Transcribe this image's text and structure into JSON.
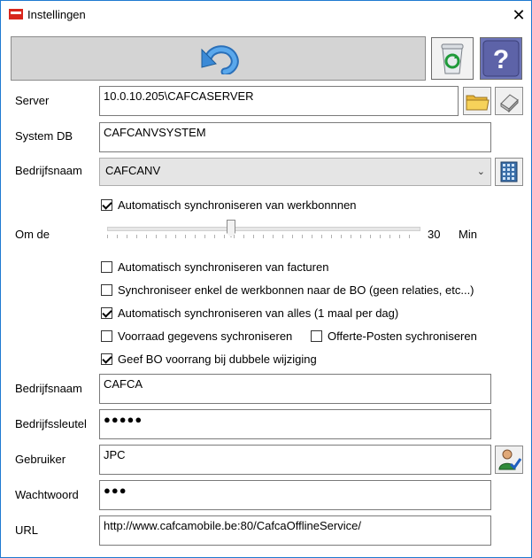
{
  "window": {
    "title": "Instellingen",
    "close_glyph": "✕"
  },
  "toolbar": {
    "undo_icon": "undo-arrow-icon",
    "recycle_icon": "recycle-bin-icon",
    "help_icon": "help-icon"
  },
  "fields": {
    "server_label": "Server",
    "server_value": "10.0.10.205\\CAFCASERVER",
    "systemdb_label": "System DB",
    "systemdb_value": "CAFCANVSYSTEM",
    "bedrijf_label": "Bedrijfsnaam",
    "bedrijf_select_value": "CAFCANV",
    "bedrijf2_label": "Bedrijfsnaam",
    "bedrijf2_value": "CAFCA",
    "sleutel_label": "Bedrijfssleutel",
    "sleutel_value": "●●●●●",
    "gebruiker_label": "Gebruiker",
    "gebruiker_value": "JPC",
    "wachtwoord_label": "Wachtwoord",
    "wachtwoord_value": "●●●",
    "url_label": "URL",
    "url_value": "http://www.cafcamobile.be:80/CafcaOfflineService/"
  },
  "sync": {
    "auto_werkbonnen": {
      "label": "Automatisch synchroniseren van werkbonnnen",
      "checked": true
    },
    "om_de_label": "Om de",
    "interval_value": "30",
    "interval_unit": "Min",
    "interval_fraction": 0.4,
    "auto_facturen": {
      "label": "Automatisch synchroniseren van facturen",
      "checked": false
    },
    "enkel_werkbonnen": {
      "label": "Synchroniseer enkel de werkbonnen naar de BO (geen relaties, etc...)",
      "checked": false
    },
    "auto_alles": {
      "label": "Automatisch synchroniseren van alles (1 maal per dag)",
      "checked": true
    },
    "voorraad": {
      "label": "Voorraad gegevens sychroniseren",
      "checked": false
    },
    "offerte": {
      "label": "Offerte-Posten sychroniseren",
      "checked": false
    },
    "voorrang": {
      "label": "Geef BO voorrang bij dubbele wijziging",
      "checked": true
    }
  }
}
